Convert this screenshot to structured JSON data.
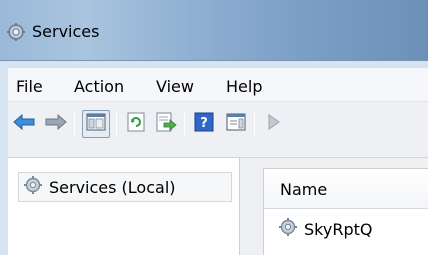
{
  "window": {
    "title": "Services",
    "icon": "gear-icon"
  },
  "menubar": {
    "items": [
      "File",
      "Action",
      "View",
      "Help"
    ]
  },
  "toolbar": {
    "buttons": [
      "back-arrow-icon",
      "forward-arrow-icon",
      "show-hide-console-tree-icon",
      "refresh-icon",
      "export-list-icon",
      "help-icon",
      "properties-icon",
      "play-icon"
    ]
  },
  "tree": {
    "root_label": "Services (Local)"
  },
  "list": {
    "columns": [
      "Name"
    ],
    "rows": [
      {
        "name": "SkyRptQ"
      }
    ]
  }
}
